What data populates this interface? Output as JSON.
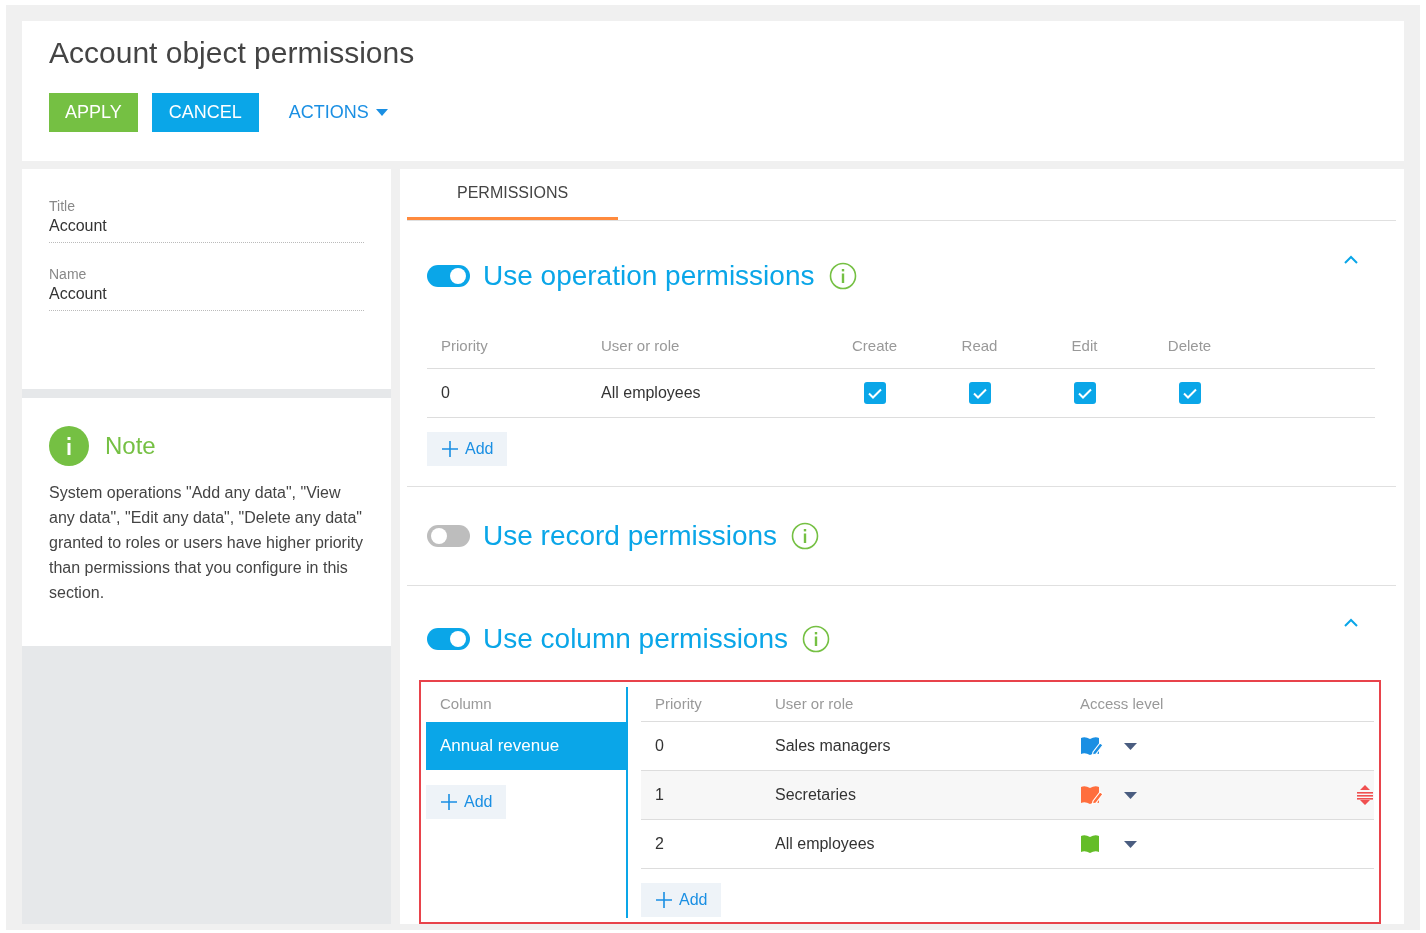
{
  "page": {
    "title": "Account object permissions"
  },
  "toolbar": [
    {
      "label": "APPLY",
      "kind": "apply"
    },
    {
      "label": "CANCEL",
      "kind": "cancel"
    },
    {
      "label": "ACTIONS",
      "kind": "menu"
    }
  ],
  "fields": [
    {
      "label": "Title",
      "value": "Account"
    },
    {
      "label": "Name",
      "value": "Account"
    }
  ],
  "note": {
    "title": "Note",
    "text": "System operations \"Add any data\", \"View any data\", \"Edit any data\", \"Delete any data\" granted to roles or users have higher priority than permissions that you configure in this section."
  },
  "tabs": [
    {
      "label": "PERMISSIONS",
      "selected": true
    }
  ],
  "operation_permissions": {
    "title": "Use operation permissions",
    "on": true,
    "expanded": true,
    "columns": [
      "Priority",
      "User or role",
      "Create",
      "Read",
      "Edit",
      "Delete"
    ],
    "rows": [
      {
        "priority": "0",
        "user_or_role": "All employees",
        "create": true,
        "read": true,
        "edit": true,
        "delete": true
      }
    ],
    "add_button": "Add"
  },
  "record_permissions": {
    "title": "Use record permissions",
    "on": false
  },
  "column_permissions": {
    "title": "Use column permissions",
    "on": true,
    "expanded": true,
    "column_list": {
      "header": "Column",
      "items": [
        {
          "label": "Annual revenue",
          "selected": true
        }
      ],
      "add_button": "Add"
    },
    "columns": [
      "Priority",
      "User or role",
      "Access level"
    ],
    "rows": [
      {
        "priority": "0",
        "user_or_role": "Sales managers",
        "kind": "edit",
        "color": "#1a8fe3",
        "highlighted": false
      },
      {
        "priority": "1",
        "user_or_role": "Secretaries",
        "kind": "edit",
        "color": "#ff6e3d",
        "highlighted": true
      },
      {
        "priority": "2",
        "user_or_role": "All employees",
        "kind": "read",
        "color": "#64bd28",
        "highlighted": false
      }
    ],
    "add_button": "Add"
  }
}
